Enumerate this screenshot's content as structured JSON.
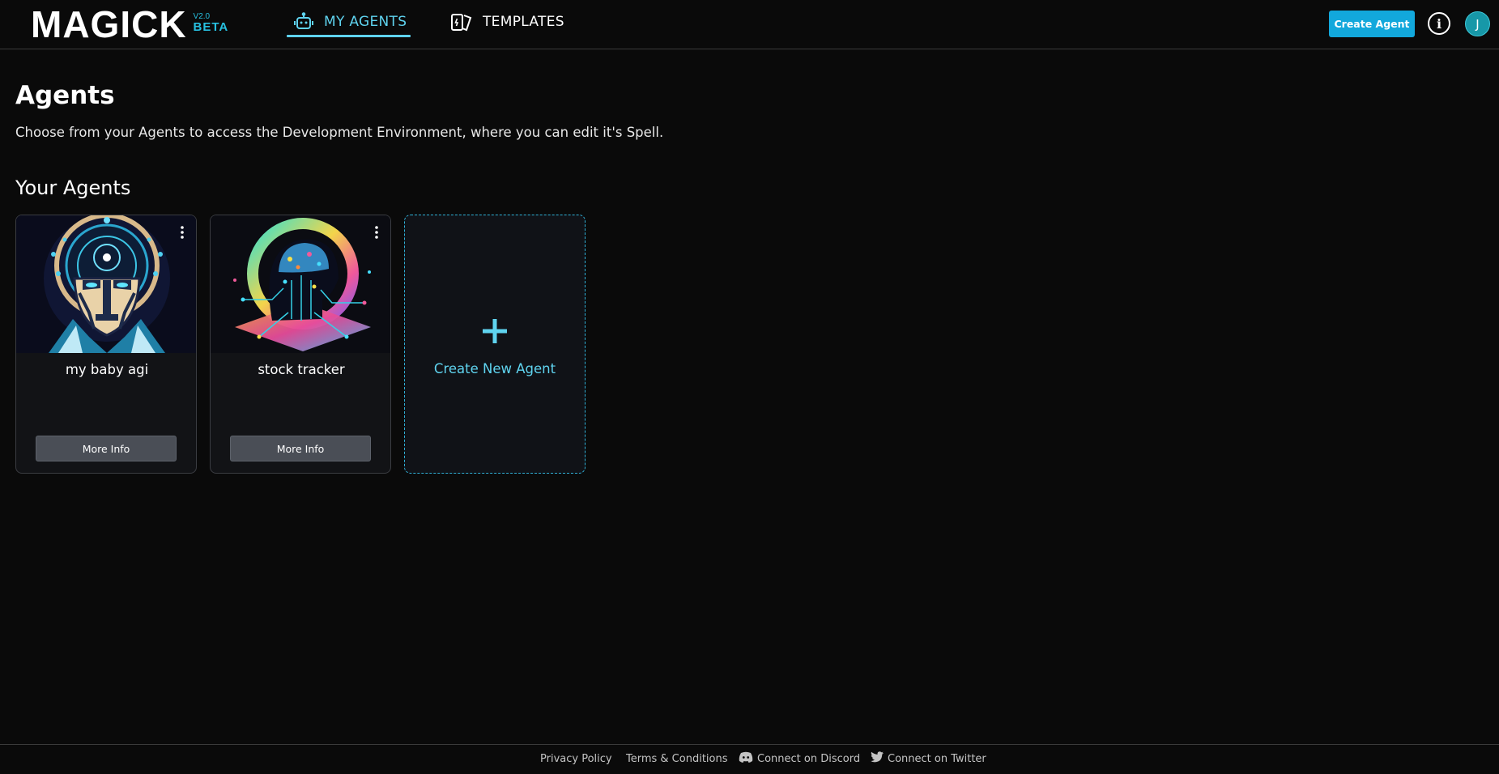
{
  "brand": {
    "name": "MAGICK",
    "version": "V2.0",
    "stage": "BETA",
    "accent_color": "#27c0e0"
  },
  "nav": {
    "tabs": [
      {
        "label": "MY AGENTS",
        "icon": "robot-icon",
        "active": true
      },
      {
        "label": "TEMPLATES",
        "icon": "template-cards-icon",
        "active": false
      }
    ]
  },
  "header": {
    "create_button": "Create Agent",
    "info_icon": "info-icon",
    "avatar_initial": "J"
  },
  "main": {
    "title": "Agents",
    "description": "Choose from your Agents to access the Development Environment, where you can edit it's Spell.",
    "section_title": "Your Agents",
    "agents": [
      {
        "name": "my baby agi",
        "button": "More Info",
        "image": "robot-face-illustration"
      },
      {
        "name": "stock tracker",
        "button": "More Info",
        "image": "circuit-head-illustration"
      }
    ],
    "new_agent": {
      "plus": "+",
      "label": "Create New Agent"
    }
  },
  "footer": {
    "links": [
      {
        "label": "Privacy Policy"
      },
      {
        "label": "Terms & Conditions"
      },
      {
        "label": "Connect on Discord",
        "icon": "discord-icon"
      },
      {
        "label": "Connect on Twitter",
        "icon": "twitter-icon"
      }
    ]
  }
}
